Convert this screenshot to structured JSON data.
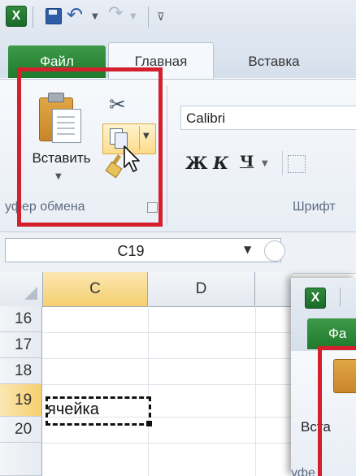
{
  "app": {
    "logo_text": "X"
  },
  "qat": {
    "save_icon": "save-icon",
    "undo_icon": "undo-icon",
    "redo_icon": "redo-icon"
  },
  "tabs": {
    "file": "Файл",
    "home": "Главная",
    "insert": "Вставка"
  },
  "clipboard": {
    "paste_label": "Вставить",
    "group_label": "уфер обмена"
  },
  "font": {
    "name": "Calibri",
    "bold": "Ж",
    "italic": "К",
    "underline": "Ч",
    "group_label": "Шрифт"
  },
  "formula_bar": {
    "name_box": "C19"
  },
  "grid": {
    "columns": [
      "C",
      "D"
    ],
    "rows": [
      "16",
      "17",
      "18",
      "19",
      "20"
    ],
    "active_row": "19",
    "active_column": "C",
    "cell_text": "ячейка"
  },
  "inset": {
    "logo_text": "X",
    "file_tab": "Фа",
    "paste_label": "Вста",
    "group_label": "уфе"
  },
  "colors": {
    "highlight": "#d4202c",
    "file_tab": "#2a8a36",
    "selection": "#f5cf6f"
  }
}
